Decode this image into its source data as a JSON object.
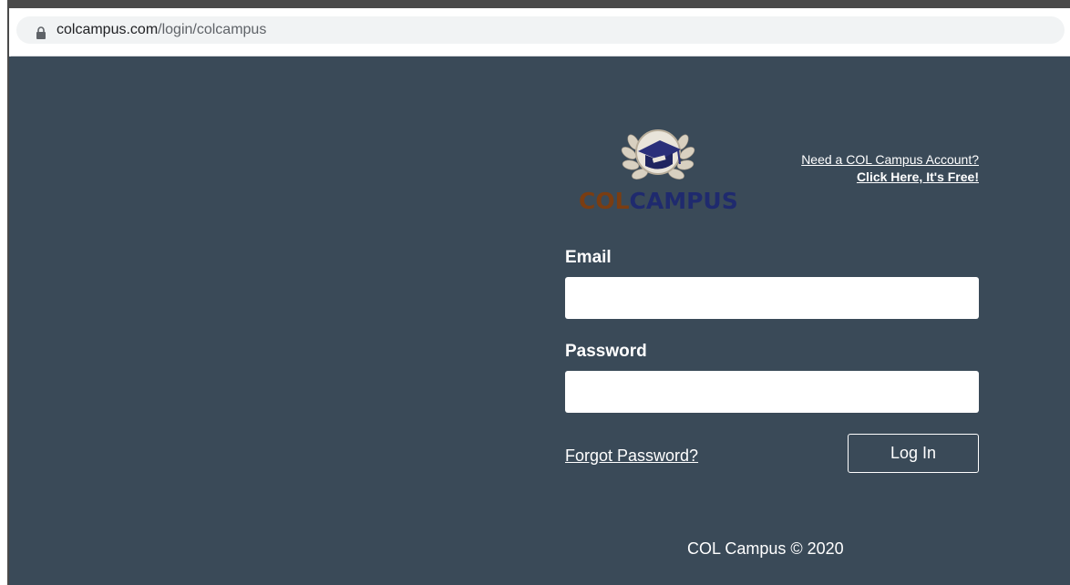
{
  "browser": {
    "url_domain": "colcampus.com",
    "url_path": "/login/colcampus"
  },
  "logo": {
    "text_col": "COL",
    "text_campus": "CAMPUS",
    "colors": {
      "col": "#7a3d12",
      "campus": "#1f2a6e",
      "cap": "#2a2f7a",
      "laurel": "#d8d0c0"
    }
  },
  "signup": {
    "line1": "Need a COL Campus Account?",
    "line2": "Click Here, It's Free!"
  },
  "form": {
    "email_label": "Email",
    "email_value": "",
    "password_label": "Password",
    "password_value": "",
    "forgot_label": "Forgot Password?",
    "login_label": "Log In"
  },
  "footer": {
    "text": "COL Campus © 2020"
  },
  "theme": {
    "background": "#3a4a58",
    "text": "#ffffff"
  }
}
